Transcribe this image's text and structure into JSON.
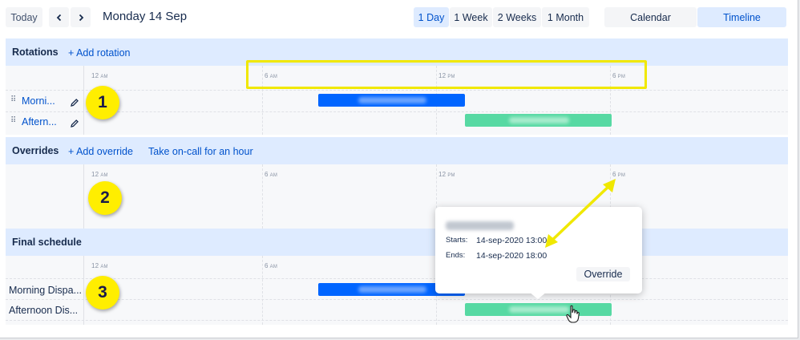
{
  "toolbar": {
    "today": "Today",
    "prev": "<",
    "next": ">",
    "date_title": "Monday 14 Sep",
    "ranges": [
      "1 Day",
      "1 Week",
      "2 Weeks",
      "1 Month"
    ],
    "active_range": "1 Day",
    "views": [
      "Calendar",
      "Timeline"
    ],
    "active_view": "Timeline"
  },
  "rotations": {
    "title": "Rotations",
    "add_link": "+ Add rotation",
    "ticks": [
      "12",
      "6",
      "12",
      "6"
    ],
    "tick_suffixes": [
      "AM",
      "AM",
      "PM",
      "PM"
    ],
    "rows": [
      {
        "label": "Morni...",
        "bar_color": "blue"
      },
      {
        "label": "Aftern...",
        "bar_color": "green"
      }
    ]
  },
  "overrides": {
    "title": "Overrides",
    "add_link": "+ Add override",
    "take_oncall_link": "Take on-call for an hour",
    "ticks": [
      "12",
      "6",
      "12",
      "6"
    ],
    "tick_suffixes": [
      "AM",
      "AM",
      "PM",
      "PM"
    ]
  },
  "final_schedule": {
    "title": "Final schedule",
    "ticks": [
      "12",
      "6"
    ],
    "tick_suffixes": [
      "AM",
      "AM"
    ],
    "rows": [
      {
        "label": "Morning Dispa..."
      },
      {
        "label": "Afternoon Dis..."
      }
    ]
  },
  "popup": {
    "starts_label": "Starts:",
    "starts_value": "14-sep-2020 13:00",
    "ends_label": "Ends:",
    "ends_value": "14-sep-2020 18:00",
    "override_button": "Override"
  },
  "annotations": {
    "badges": [
      "1",
      "2",
      "3"
    ],
    "badge_color": "#ffee00",
    "highlight_color": "#f0e800"
  },
  "colors": {
    "accent": "#0052cc",
    "band": "#deebff",
    "blue_bar": "#0065ff",
    "green_bar": "#57d9a3"
  }
}
